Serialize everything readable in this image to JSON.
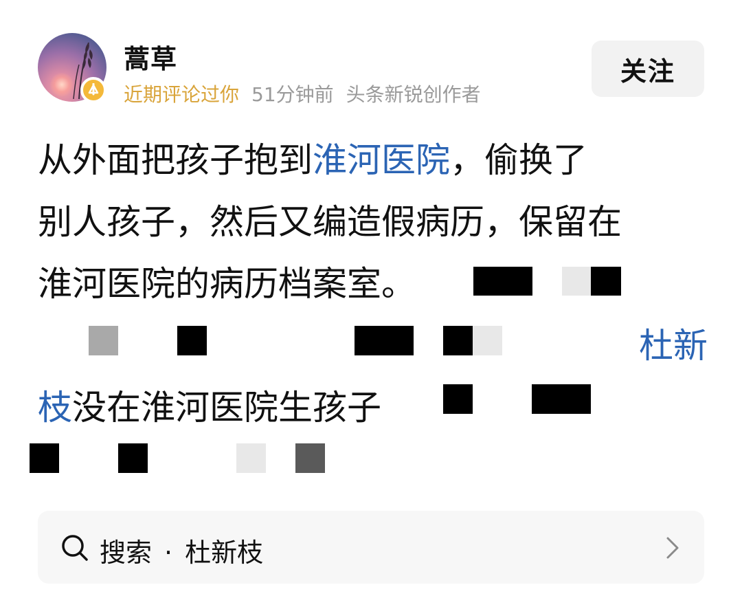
{
  "post": {
    "author": {
      "name": "蒿草",
      "tag": "近期评论过你",
      "time": "51分钟前",
      "role": "头条新锐创作者"
    },
    "follow_label": "关注",
    "text": {
      "line1_a": "从外面把孩子抱到",
      "line1_link": "淮河医院",
      "line1_b": "，偷换了",
      "line2": "别人孩子，然后又编造假病历，保留在",
      "line3": "淮河医院的病历档案室。",
      "line4_link": "杜新",
      "line5_link": "枝",
      "line5_b": "没在淮河医院生孩子"
    }
  },
  "search": {
    "label": "搜索",
    "separator": "·",
    "query": "杜新枝"
  },
  "colors": {
    "link": "#2b64b4",
    "tag": "#d9a43a",
    "meta": "#9a9a9a",
    "badge": "#f4b93a"
  },
  "icons": {
    "badge": "creator-badge-icon",
    "search": "search-icon",
    "chevron": "chevron-right-icon"
  }
}
